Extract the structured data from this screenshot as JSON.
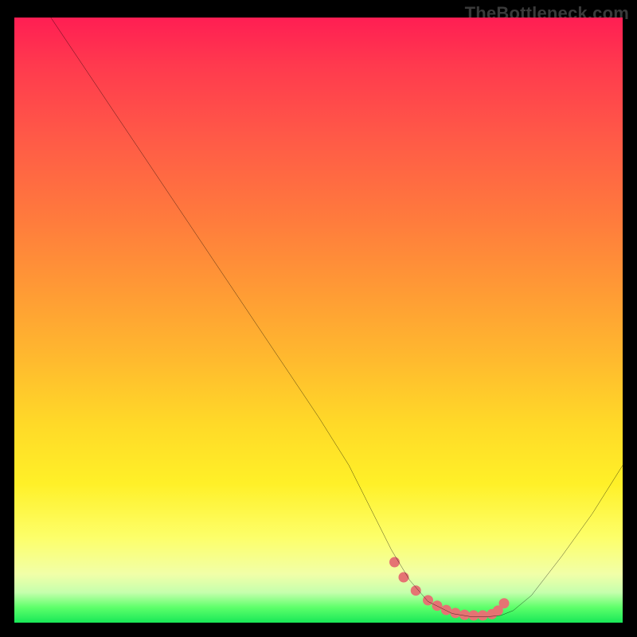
{
  "watermark": "TheBottleneck.com",
  "chart_data": {
    "type": "line",
    "title": "",
    "xlabel": "",
    "ylabel": "",
    "xlim": [
      0,
      100
    ],
    "ylim": [
      0,
      100
    ],
    "grid": false,
    "legend": false,
    "series": [
      {
        "name": "main-curve",
        "color": "#000000",
        "x": [
          6,
          10,
          15,
          20,
          25,
          30,
          35,
          40,
          45,
          50,
          55,
          58,
          60,
          62,
          65,
          68,
          72,
          75,
          78,
          80,
          82,
          85,
          90,
          95,
          100
        ],
        "y": [
          100,
          94,
          86.5,
          79,
          71.5,
          64,
          56.5,
          49,
          41.5,
          34,
          26,
          20,
          16,
          12,
          7,
          3.5,
          1.5,
          1,
          1,
          1.2,
          2,
          4.5,
          11,
          18,
          26
        ]
      },
      {
        "name": "highlight-dots",
        "color": "#e57373",
        "type": "scatter",
        "x": [
          62.5,
          64,
          66,
          68,
          69.5,
          71,
          72.5,
          74,
          75.5,
          77,
          78.5,
          79.5,
          80.5
        ],
        "y": [
          10,
          7.5,
          5.3,
          3.7,
          2.8,
          2.1,
          1.6,
          1.3,
          1.2,
          1.2,
          1.4,
          2.0,
          3.2
        ]
      }
    ],
    "gradient_stops": [
      {
        "pos": 0.0,
        "color": "#ff1e53"
      },
      {
        "pos": 0.45,
        "color": "#ff9a35"
      },
      {
        "pos": 0.77,
        "color": "#fff028"
      },
      {
        "pos": 0.95,
        "color": "#c6ffad"
      },
      {
        "pos": 1.0,
        "color": "#18e858"
      }
    ]
  }
}
